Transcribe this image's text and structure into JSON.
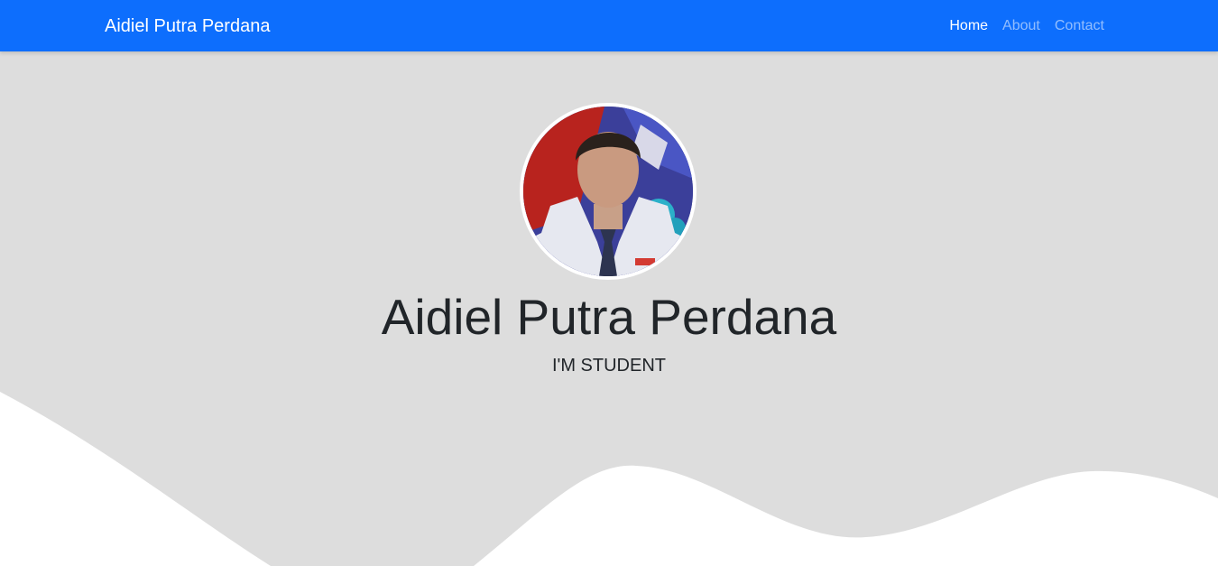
{
  "navbar": {
    "brand": "Aidiel Putra Perdana",
    "links": [
      {
        "label": "Home",
        "active": true
      },
      {
        "label": "About",
        "active": false
      },
      {
        "label": "Contact",
        "active": false
      }
    ],
    "color": "#0d6efd"
  },
  "hero": {
    "name": "Aidiel Putra Perdana",
    "tagline": "I'M STUDENT",
    "background": "#dddddd"
  }
}
